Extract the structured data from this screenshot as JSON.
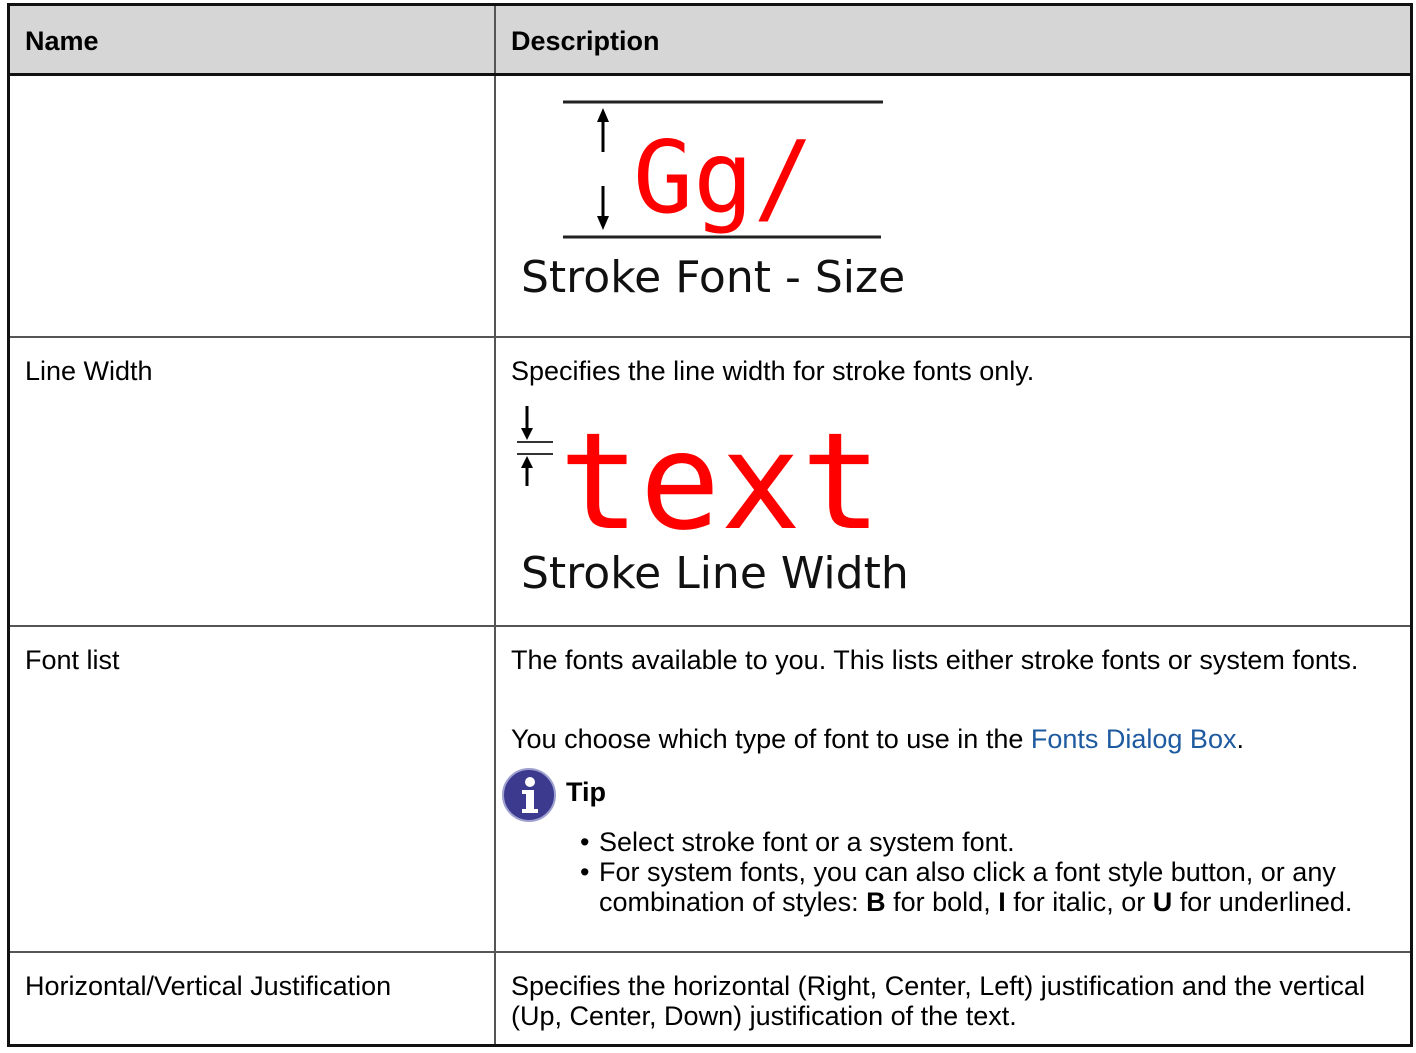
{
  "table": {
    "headers": {
      "name": "Name",
      "description": "Description"
    },
    "stroke_size": {
      "glyphs": "Gg/",
      "caption": "Stroke Font - Size"
    },
    "line_width": {
      "name": "Line Width",
      "description": "Specifies the line width for stroke fonts only.",
      "glyphs": "text",
      "caption": "Stroke Line Width"
    },
    "font_list": {
      "name": "Font list",
      "description_line1": "The fonts available to you. This lists either stroke fonts or system fonts.",
      "description_line2_before": "You choose which type of font to use in the ",
      "description_link": "Fonts Dialog Box",
      "description_line2_after": ".",
      "tip_label": "Tip",
      "tip_items": {
        "item1": "Select stroke font or a system font.",
        "item2_a": "For system fonts, you can also click a font style button, or any combination of styles: ",
        "bold_key": "B",
        "item2_b": " for bold, ",
        "italic_key": "I",
        "item2_c": " for italic, or ",
        "underline_key": "U",
        "item2_d": " for underlined."
      }
    },
    "justification": {
      "name": "Horizontal/Vertical Justification",
      "description": "Specifies the horizontal (Right, Center, Left) justification and the vertical (Up, Center, Down) justification of the text."
    }
  },
  "colors": {
    "glyph_red": "#ff0000",
    "header_bg": "#d6d6d6",
    "link": "#1e5aa0",
    "tip_icon": "#3b3a8f"
  },
  "icons": {
    "tip": "info-icon"
  }
}
